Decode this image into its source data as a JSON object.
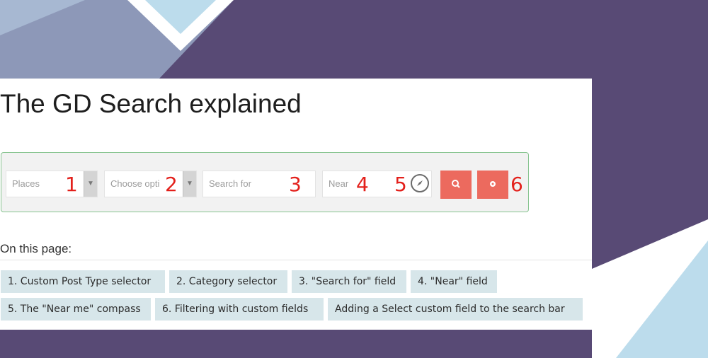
{
  "page": {
    "title": "The GD Search explained",
    "on_this_page": "On this page:"
  },
  "searchbar": {
    "post_type": {
      "value": "Places"
    },
    "category": {
      "value": "Choose opti"
    },
    "search_for": {
      "placeholder": "Search for"
    },
    "near": {
      "placeholder": "Near"
    }
  },
  "annotations": [
    "1",
    "2",
    "3",
    "4",
    "5",
    "6"
  ],
  "toc": {
    "row1": [
      "1. Custom Post Type selector",
      "2. Category selector",
      "3. \"Search for\" field",
      "4. \"Near\" field"
    ],
    "row2": [
      "5. The \"Near me\" compass",
      "6. Filtering with custom fields",
      "Adding a Select custom field to the search bar"
    ]
  },
  "colors": {
    "background": "#584a75",
    "button": "#ec6a5e",
    "annotation": "#e3201b",
    "chip": "#d7e6ea",
    "border": "#86c48f"
  },
  "icons": {
    "search_button": "search-icon",
    "filter_button": "gear-icon",
    "compass": "compass-icon"
  }
}
